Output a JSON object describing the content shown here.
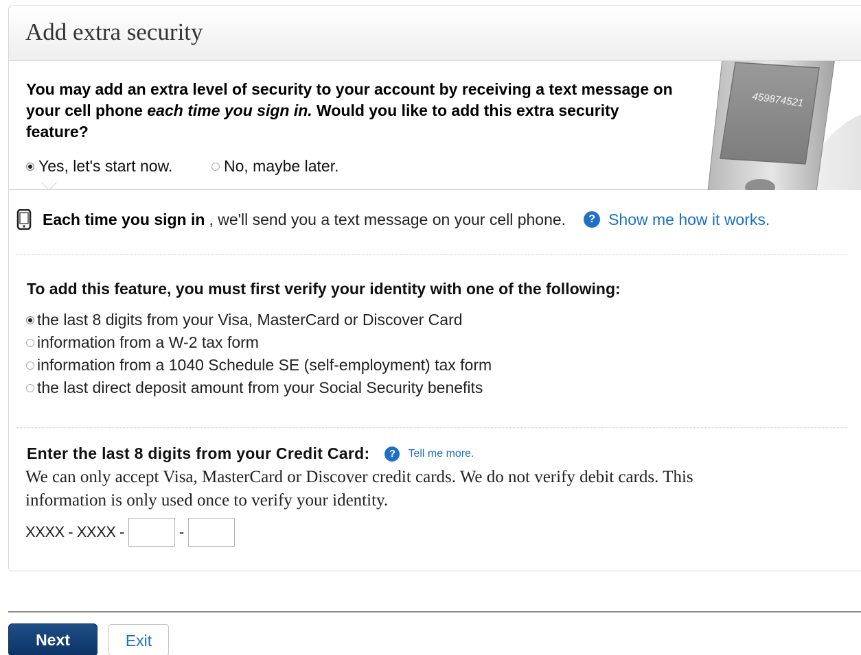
{
  "header": {
    "title": "Add extra security"
  },
  "intro": {
    "text_part1": "You may add an extra level of security to your account by receiving a text message on your cell phone ",
    "text_em": "each time you sign in.",
    "text_part2": " Would you like to add this extra security feature?",
    "choice_yes": "Yes, let's start now.",
    "choice_no": "No, maybe later.",
    "selected": "yes",
    "phone_display_number": "459874521"
  },
  "info": {
    "bold": "Each time you sign in",
    "rest": ", we'll send you a text message on your cell phone.",
    "help_link": "Show me how it works."
  },
  "verify": {
    "title": "To add this feature, you must first verify your identity with one of the following:",
    "options": [
      "the last 8 digits from your Visa, MasterCard or Discover Card",
      "information from a W-2 tax form",
      "information from a 1040 Schedule SE (self-employment) tax form",
      "the last direct deposit amount from your Social Security benefits"
    ],
    "selected_index": 0
  },
  "credit_card": {
    "title": "Enter the last 8 digits from your Credit Card:",
    "help_link": "Tell me more.",
    "description": "We can only accept Visa, MasterCard or Discover credit cards. We do not verify debit cards. This information is only used once to verify your identity.",
    "mask_prefix": "XXXX - XXXX -",
    "separator": "-",
    "field1_value": "",
    "field2_value": ""
  },
  "actions": {
    "next_label": "Next",
    "exit_label": "Exit"
  },
  "colors": {
    "link": "#1a6fc4",
    "primary_button": "#0d3366"
  }
}
